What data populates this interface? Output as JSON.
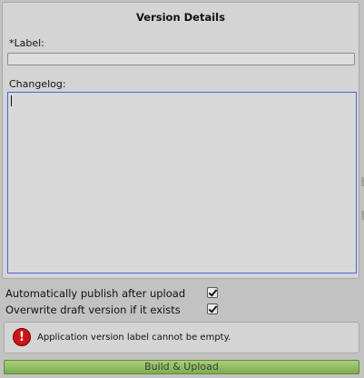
{
  "panel": {
    "title": "Version Details",
    "label_caption": "*Label:",
    "label_value": "",
    "changelog_caption": "Changelog:",
    "changelog_value": ""
  },
  "options": [
    {
      "label": "Automatically publish after upload",
      "checked": true
    },
    {
      "label": "Overwrite draft version if it exists",
      "checked": true
    }
  ],
  "alert": {
    "icon": "error-icon",
    "icon_glyph": "!",
    "message": "Application version label cannot be empty."
  },
  "actions": {
    "build_upload_label": "Build & Upload"
  }
}
